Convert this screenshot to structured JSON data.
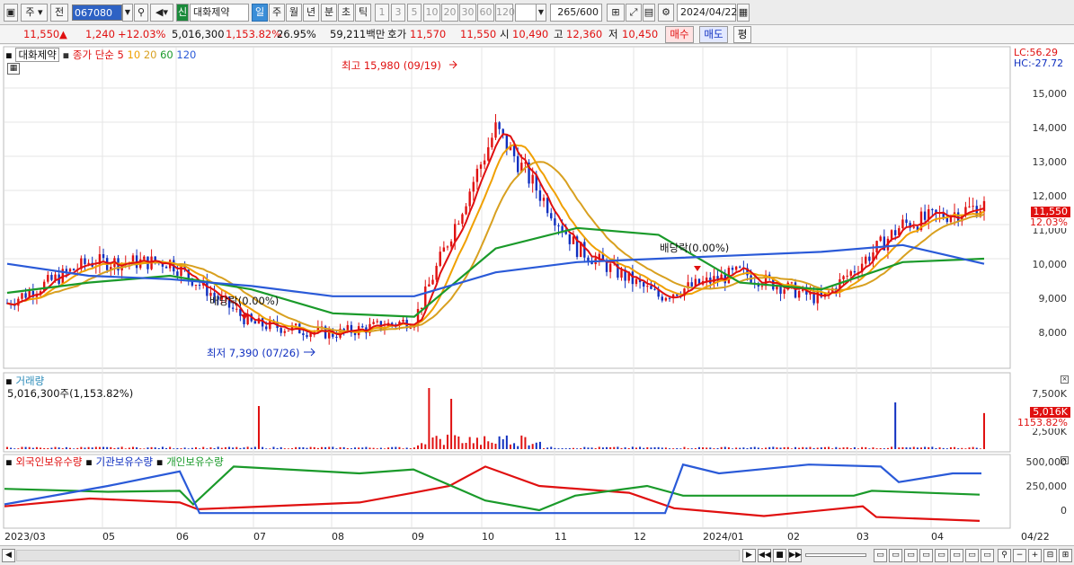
{
  "toolbar": {
    "market": "주",
    "all": "전",
    "code": "067080",
    "badge": "신",
    "name": "대화제약",
    "periods": [
      "일",
      "주",
      "월",
      "년",
      "분",
      "초",
      "틱"
    ],
    "intervals": [
      "1",
      "3",
      "5",
      "10",
      "20",
      "30",
      "60",
      "120"
    ],
    "count": "265",
    "count_total": "/600",
    "date": "2024/04/22"
  },
  "quote": {
    "price": "11,550",
    "arrow": "▲",
    "change": "1,240",
    "change_pct": "+12.03%",
    "volume": "5,016,300",
    "volume_pct": "1,153.82%",
    "turnover": "26.95%",
    "amount": "59,211백만",
    "ask_label": "호가",
    "ask": "11,570",
    "bid": "11,550",
    "open_label": "시",
    "open": "10,490",
    "high_label": "고",
    "high": "12,360",
    "low_label": "저",
    "low": "10,450",
    "buy": "매수",
    "sell": "매도",
    "eval": "평"
  },
  "price_panel": {
    "stock_name": "대화제약",
    "ma_title": "종가 단순",
    "ma_periods": [
      "5",
      "10",
      "20",
      "60",
      "120"
    ],
    "lc": "LC:56.29",
    "hc": "HC:-27.72",
    "yticks": [
      "15,000",
      "14,000",
      "13,000",
      "12,000",
      "11,000",
      "10,000",
      "9,000",
      "8,000"
    ],
    "last_price": "11,550",
    "last_pct": "12.03%",
    "high_note": "최고 15,980 (09/19)",
    "low_note": "최저 7,390 (07/26)",
    "div_note_1": "배당락(0.00%)",
    "div_note_2": "배당락(0.00%)"
  },
  "volume_panel": {
    "title": "거래량",
    "value": "5,016,300주(1,153.82%)",
    "yticks": [
      "7,500K",
      "2,500K"
    ],
    "last": "5,016K",
    "last_pct": "1153.82%"
  },
  "holder_panel": {
    "foreign": "외국인보유수량",
    "inst": "기관보유수량",
    "retail": "개인보유수량",
    "yticks": [
      "500,000",
      "250,000",
      "0"
    ]
  },
  "xaxis": [
    "2023/03",
    "05",
    "06",
    "07",
    "08",
    "09",
    "10",
    "11",
    "12",
    "2024/01",
    "02",
    "03",
    "04",
    "04/22"
  ],
  "colors": {
    "up": "#e01010",
    "down": "#1030c0",
    "ma5": "#e01010",
    "ma10": "#f0a000",
    "ma20": "#d8a020",
    "ma60": "#1a9a2a",
    "ma120": "#2a5ad8"
  },
  "chart_data": {
    "type": "candlestick",
    "title": "대화제약",
    "dates": [
      "2023/03",
      "05",
      "06",
      "07",
      "08",
      "09",
      "10",
      "11",
      "12",
      "2024/01",
      "02",
      "03",
      "04"
    ],
    "close": [
      8700,
      9900,
      9900,
      8100,
      7800,
      8200,
      13800,
      10300,
      8900,
      9600,
      8800,
      11000,
      11550
    ],
    "ma60": [
      9000,
      9300,
      9500,
      9100,
      8400,
      8300,
      10300,
      10900,
      10700,
      9300,
      9100,
      9900,
      10000
    ],
    "ma120": [
      9850,
      9500,
      9400,
      9200,
      8900,
      8900,
      9600,
      9900,
      10000,
      10100,
      10200,
      10400,
      9850
    ],
    "volume_spikes_k": [
      6000,
      8500,
      7000,
      6500,
      5016
    ],
    "high": 15980,
    "high_date": "09/19",
    "low": 7390,
    "low_date": "07/26",
    "ylim": [
      7000,
      16000
    ]
  }
}
